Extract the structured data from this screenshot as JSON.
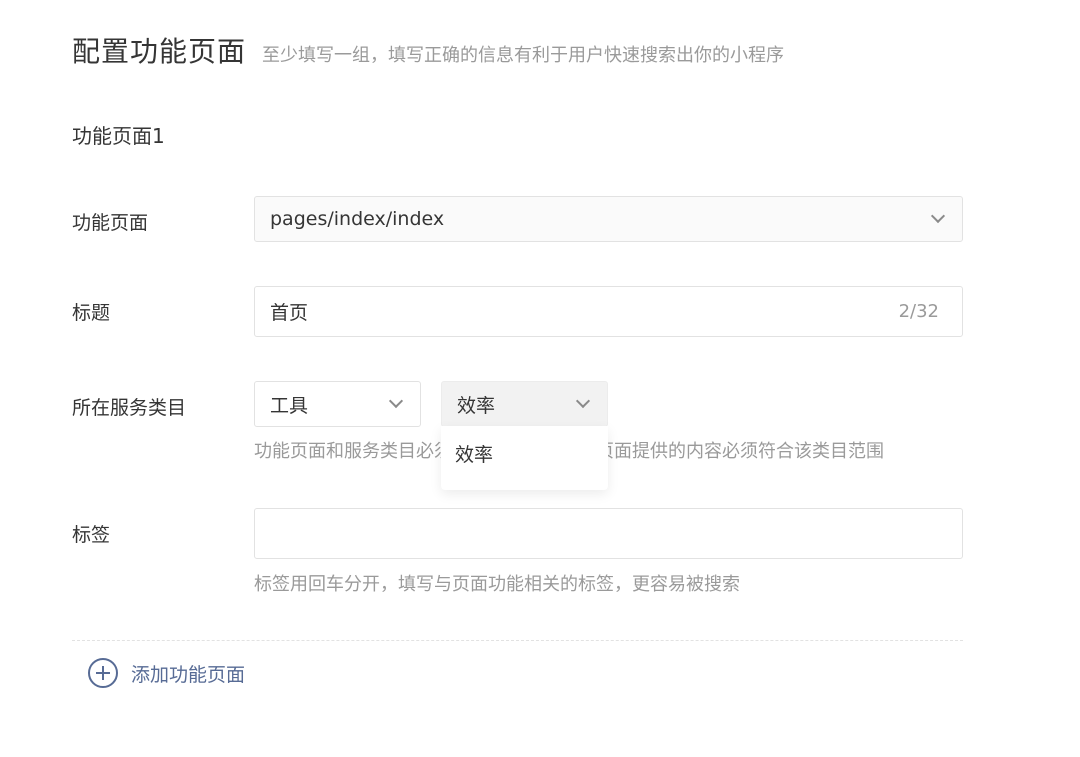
{
  "header": {
    "title": "配置功能页面",
    "description": "至少填写一组，填写正确的信息有利于用户快速搜索出你的小程序"
  },
  "section": {
    "title": "功能页面1"
  },
  "fields": {
    "page": {
      "label": "功能页面",
      "value": "pages/index/index",
      "icon": "chevron-down-icon"
    },
    "title": {
      "label": "标题",
      "value": "首页",
      "counter": "2/32"
    },
    "category": {
      "label": "所在服务类目",
      "primary": "工具",
      "secondary": "效率",
      "help": "功能页面和服务类目必须一一对应，且功能页面提供的内容必须符合该类目范围",
      "dropdown_options": [
        "效率"
      ]
    },
    "tags": {
      "label": "标签",
      "value": "",
      "help": "标签用回车分开，填写与页面功能相关的标签，更容易被搜索"
    }
  },
  "actions": {
    "add_page": "添加功能页面",
    "add_icon": "plus-circle-icon"
  },
  "colors": {
    "link": "#576b95",
    "muted": "#9a9a9a",
    "text": "#353535",
    "border": "#e2e2e2"
  }
}
